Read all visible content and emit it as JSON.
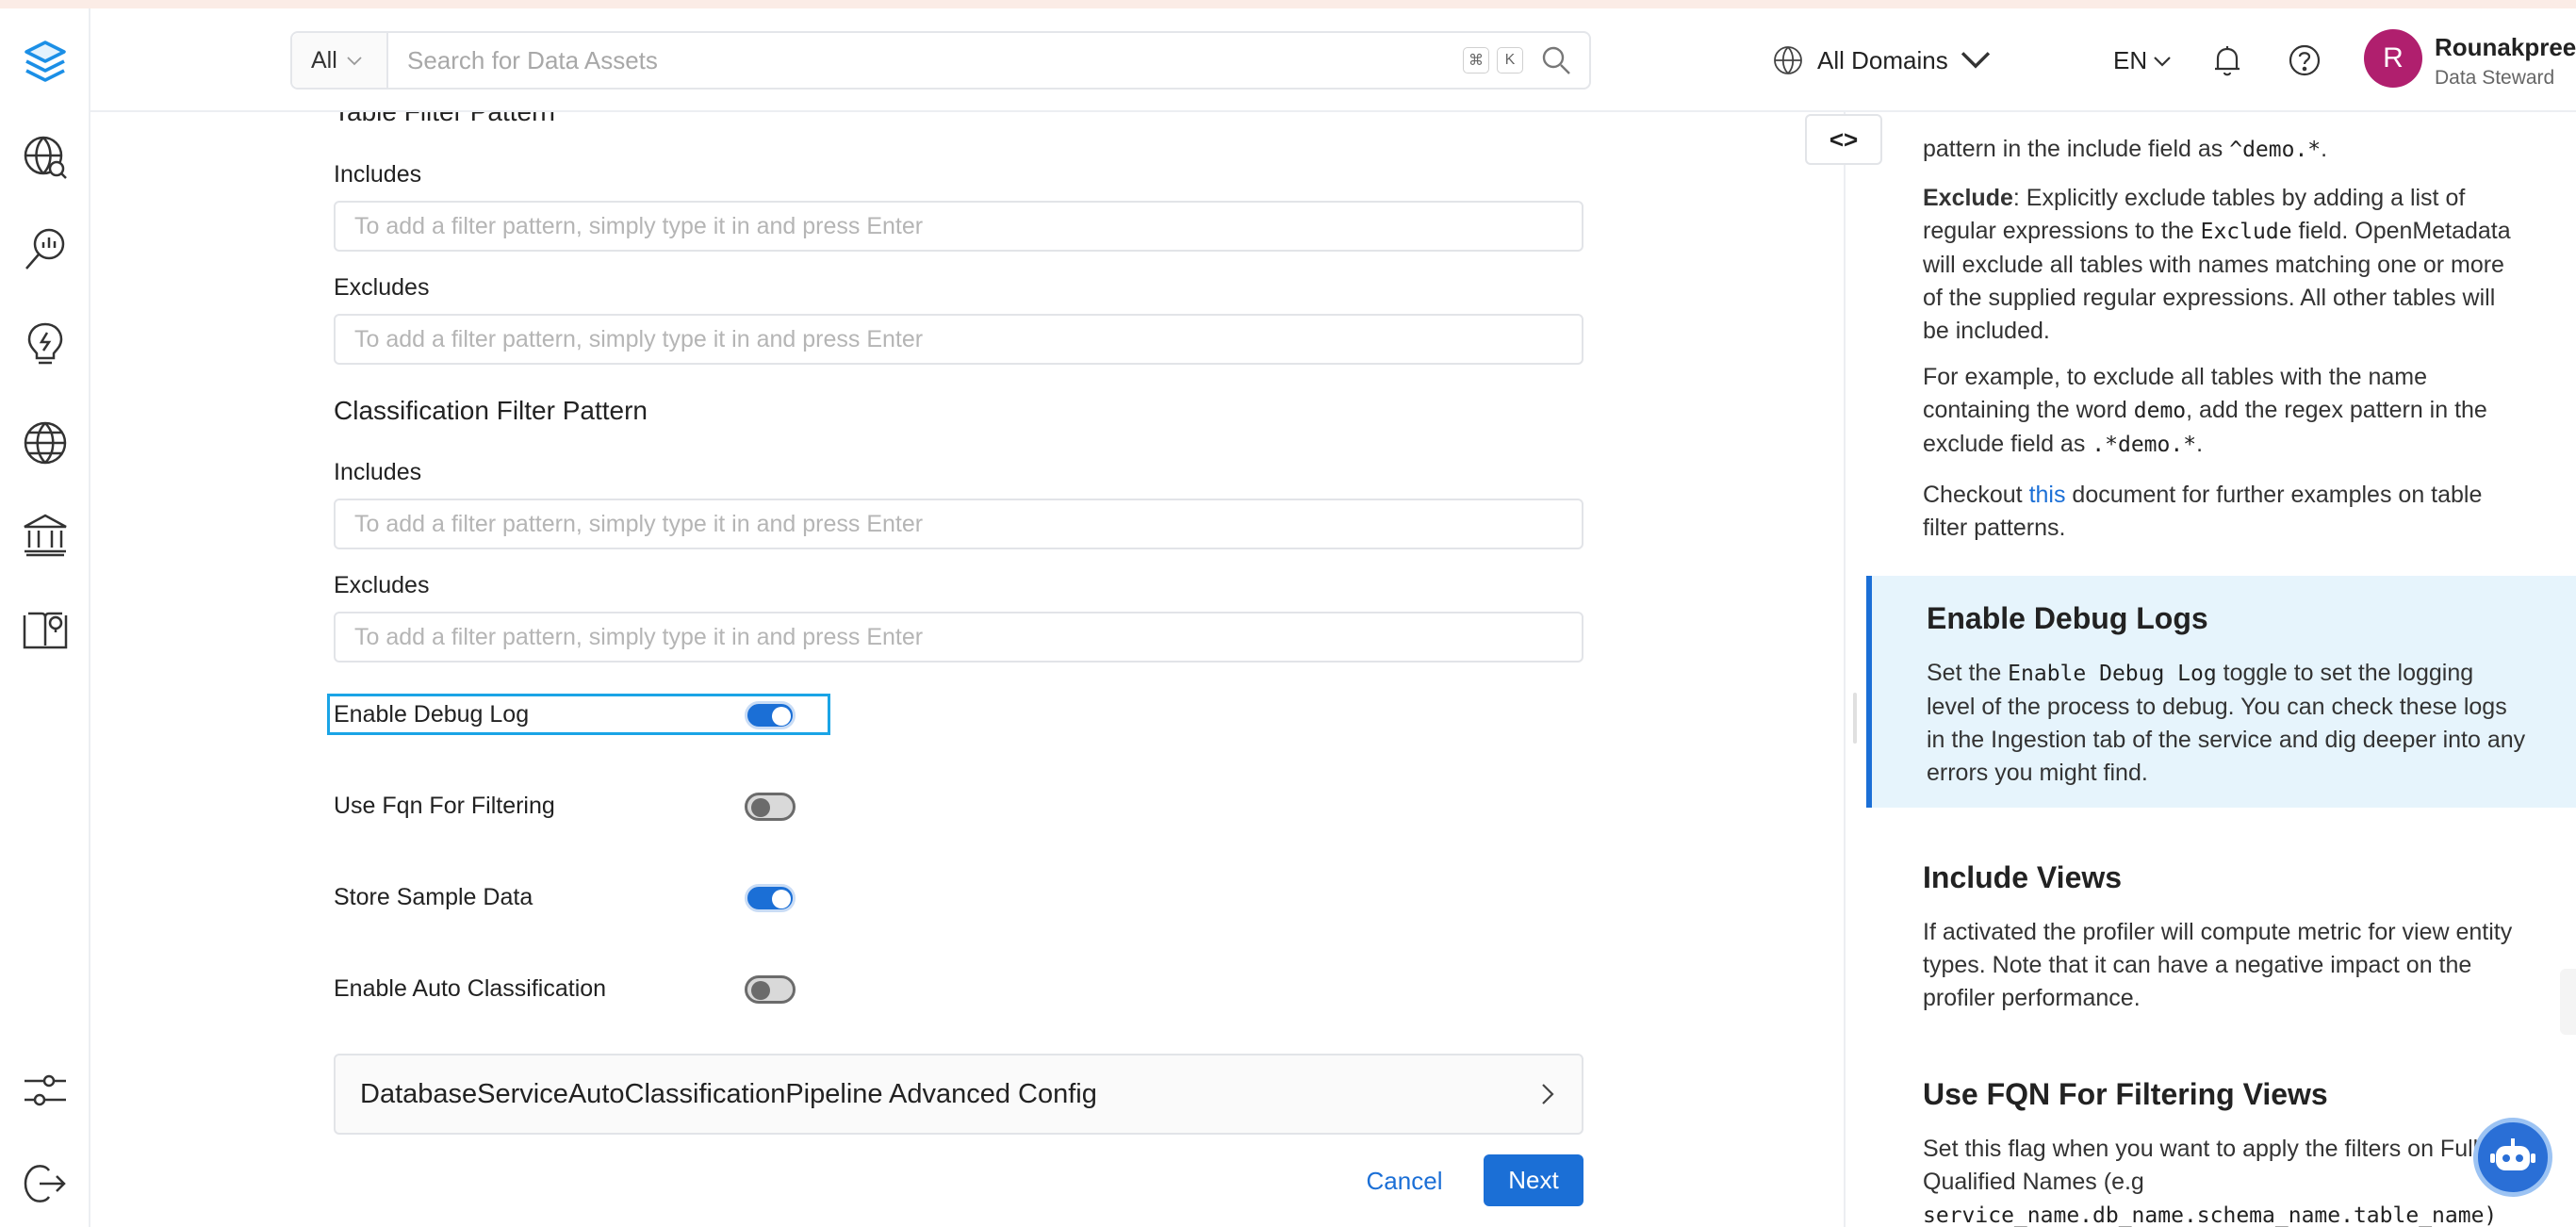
{
  "header": {
    "search": {
      "scope": "All",
      "placeholder": "Search for Data Assets",
      "shortcut_key1": "⌘",
      "shortcut_key2": "K"
    },
    "domains_label": "All Domains",
    "language": "EN",
    "user": {
      "initial": "R",
      "name": "Rounakpreet.d",
      "role": "Data Steward"
    }
  },
  "form": {
    "table_filter": {
      "title": "Table Filter Pattern",
      "includes_label": "Includes",
      "excludes_label": "Excludes",
      "placeholder": "To add a filter pattern, simply type it in and press Enter"
    },
    "classification_filter": {
      "title": "Classification Filter Pattern",
      "includes_label": "Includes",
      "excludes_label": "Excludes",
      "placeholder": "To add a filter pattern, simply type it in and press Enter"
    },
    "toggles": [
      {
        "label": "Enable Debug Log",
        "on": true
      },
      {
        "label": "Use Fqn For Filtering",
        "on": false
      },
      {
        "label": "Store Sample Data",
        "on": true
      },
      {
        "label": "Enable Auto Classification",
        "on": false
      }
    ],
    "advanced_config_label": "DatabaseServiceAutoClassificationPipeline Advanced Config",
    "cancel_label": "Cancel",
    "next_label": "Next"
  },
  "docs": {
    "p1_text": "pattern in the include field as ",
    "p1_code": "^demo.*",
    "p1_end": ".",
    "exclude_bold": "Exclude",
    "exclude_text1": ": Explicitly exclude tables by adding a list of regular expressions to the ",
    "exclude_code": "Exclude",
    "exclude_text2": " field. OpenMetadata will exclude all tables with names matching one or more of the supplied regular expressions. All other tables will be included.",
    "example_text1": "For example, to exclude all tables with the name containing the word ",
    "example_code1": "demo",
    "example_text2": ", add the regex pattern in the exclude field as ",
    "example_code2": ".*demo.*",
    "example_end": ".",
    "checkout_text1": "Checkout ",
    "checkout_link": "this",
    "checkout_text2": " document for further examples on table filter patterns.",
    "debug_title": "Enable Debug Logs",
    "debug_text1": "Set the ",
    "debug_code": "Enable Debug Log",
    "debug_text2": " toggle to set the logging level of the process to debug. You can check these logs in the Ingestion tab of the service and dig deeper into any errors you might find.",
    "views_title": "Include Views",
    "views_text": "If activated the profiler will compute metric for view entity types. Note that it can have a negative impact on the profiler performance.",
    "fqn_title": "Use FQN For Filtering Views",
    "fqn_text": "Set this flag when you want to apply the filters on Fully Qualified Names (e.g",
    "fqn_code": "service_name.db_name.schema_name.table_name)"
  }
}
